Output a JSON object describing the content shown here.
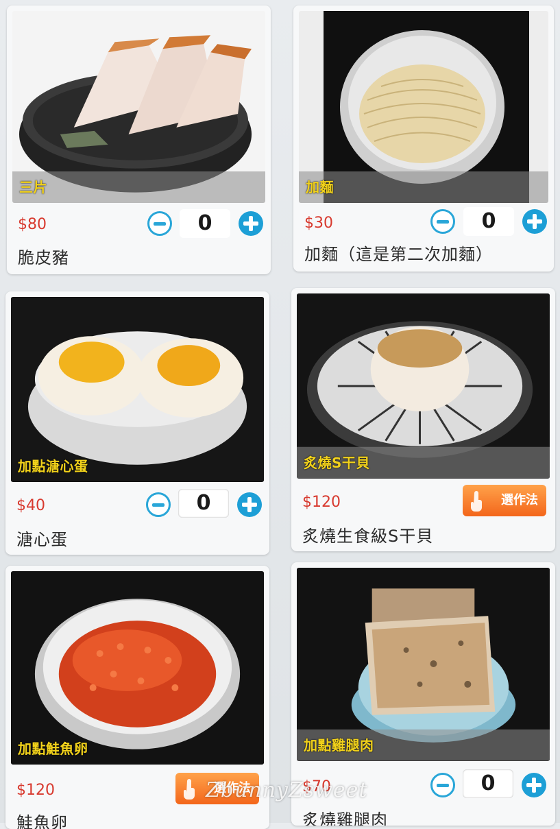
{
  "items": [
    {
      "caption": "三片",
      "price": "$80",
      "name": "脆皮豬",
      "qty": "0"
    },
    {
      "caption": "加麵",
      "price": "$30",
      "name": "加麵（這是第二次加麵）",
      "qty": "0"
    },
    {
      "caption": "加點溏心蛋",
      "price": "$40",
      "name": "溏心蛋",
      "qty": "0"
    },
    {
      "caption": "炙燒S干貝",
      "price": "$120",
      "name": "炙燒生食級S干貝",
      "choose": "選作法"
    },
    {
      "caption": "加點鮭魚卵",
      "price": "$120",
      "name": "鮭魚卵",
      "choose": "選作法"
    },
    {
      "caption": "加點雞腿肉",
      "price": "$70",
      "name": "炙燒雞腿肉",
      "qty": "0"
    }
  ],
  "watermark": "ZbunnyZsweet",
  "colors": {
    "price": "#d83a2f",
    "accent": "#1d9fd6",
    "caption": "#f2d21b",
    "choose": "#f3661b"
  },
  "icons": {
    "minus": "minus-circle-icon",
    "plus": "plus-circle-icon",
    "hand": "tap-hand-icon"
  }
}
